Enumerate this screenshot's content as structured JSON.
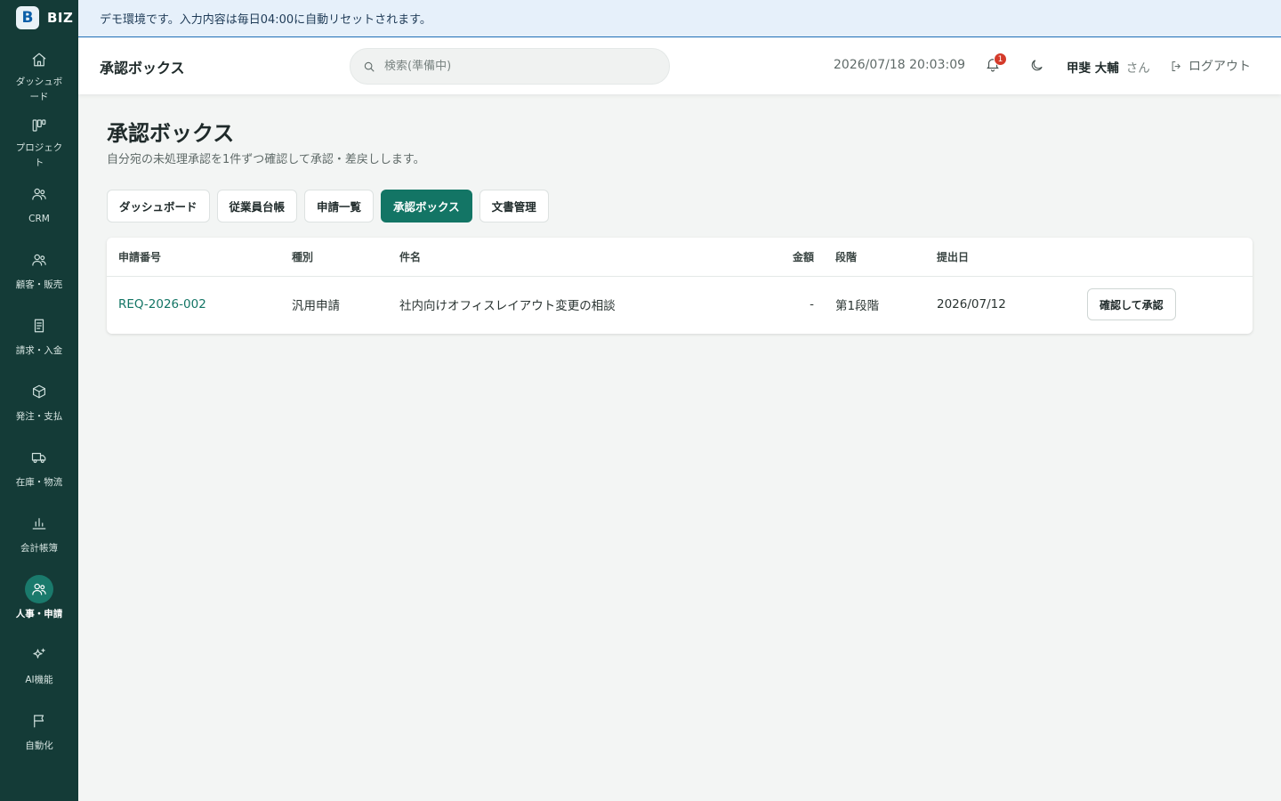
{
  "brand": {
    "logo_letter": "B",
    "name": "BIZ"
  },
  "banner": {
    "text": "デモ環境です。入力内容は毎日04:00に自動リセットされます。"
  },
  "sidebar": {
    "items": [
      {
        "label": "ダッシュボード",
        "icon": "home-icon"
      },
      {
        "label": "プロジェクト",
        "icon": "kanban-icon"
      },
      {
        "label": "CRM",
        "icon": "users-icon"
      },
      {
        "label": "顧客・販売",
        "icon": "users-icon"
      },
      {
        "label": "請求・入金",
        "icon": "receipt-icon"
      },
      {
        "label": "発注・支払",
        "icon": "box-icon"
      },
      {
        "label": "在庫・物流",
        "icon": "truck-icon"
      },
      {
        "label": "会計帳簿",
        "icon": "bar-chart-icon"
      },
      {
        "label": "人事・申請",
        "icon": "users-icon",
        "active": true
      },
      {
        "label": "AI機能",
        "icon": "sparkles-icon"
      },
      {
        "label": "自動化",
        "icon": "flag-icon"
      }
    ]
  },
  "header": {
    "title": "承認ボックス",
    "search_placeholder": "検索(準備中)",
    "datetime": "2026/07/18 20:03:09",
    "notification_count": "1",
    "user_name": "甲斐 大輔",
    "user_suffix": "さん",
    "logout_label": "ログアウト"
  },
  "main": {
    "title": "承認ボックス",
    "subtitle": "自分宛の未処理承認を1件ずつ確認して承認・差戻しします。",
    "tabs": [
      {
        "label": "ダッシュボード"
      },
      {
        "label": "従業員台帳"
      },
      {
        "label": "申請一覧"
      },
      {
        "label": "承認ボックス",
        "active": true
      },
      {
        "label": "文書管理"
      }
    ],
    "table": {
      "columns": [
        "申請番号",
        "種別",
        "件名",
        "金額",
        "段階",
        "提出日"
      ],
      "rows": [
        {
          "id": "REQ-2026-002",
          "type": "汎用申請",
          "subject": "社内向けオフィスレイアウト変更の相談",
          "amount": "-",
          "stage": "第1段階",
          "date": "2026/07/12",
          "action": "確認して承認"
        }
      ]
    }
  },
  "colors": {
    "sidebar_bg": "#143b37",
    "accent": "#137565",
    "badge": "#d43a2a",
    "banner_bg": "#e6f0fa"
  }
}
